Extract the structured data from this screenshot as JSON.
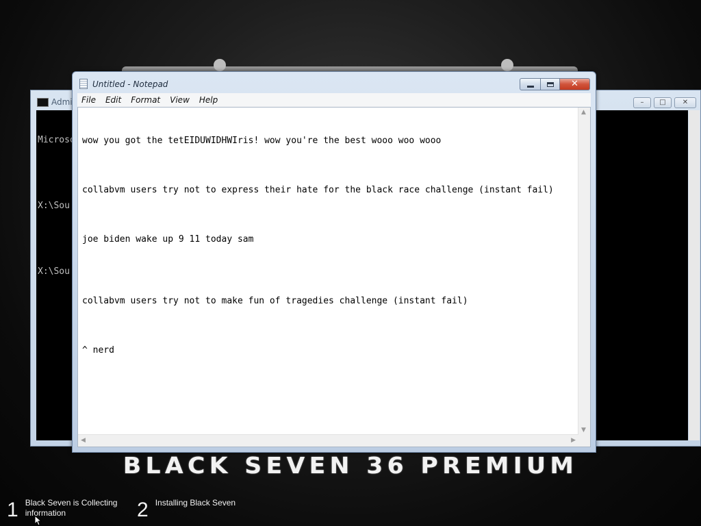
{
  "cmd_window": {
    "title": "Admi",
    "lines": [
      "Microso",
      "",
      "X:\\Sou",
      "",
      "X:\\Sou"
    ]
  },
  "notepad": {
    "title": "Untitled - Notepad",
    "menu": [
      "File",
      "Edit",
      "Format",
      "View",
      "Help"
    ],
    "lines": [
      "wow you got the tetEIDUWIDHWIris! wow you're the best wooo woo wooo",
      "collabvm users try not to express their hate for the black race challenge (instant fail)",
      "joe biden wake up 9 11 today sam",
      "collabvm users try not to make fun of tragedies challenge (instant fail)",
      "^ nerd"
    ]
  },
  "banner": {
    "text": "BLACK SEVEN 36 PREMIUM"
  },
  "steps": [
    {
      "number": "1",
      "label": "Black Seven is Collecting information"
    },
    {
      "number": "2",
      "label": "Installing Black Seven"
    }
  ],
  "colors": {
    "banner_text": "#f2f2f2",
    "close_button": "#c33b22"
  }
}
